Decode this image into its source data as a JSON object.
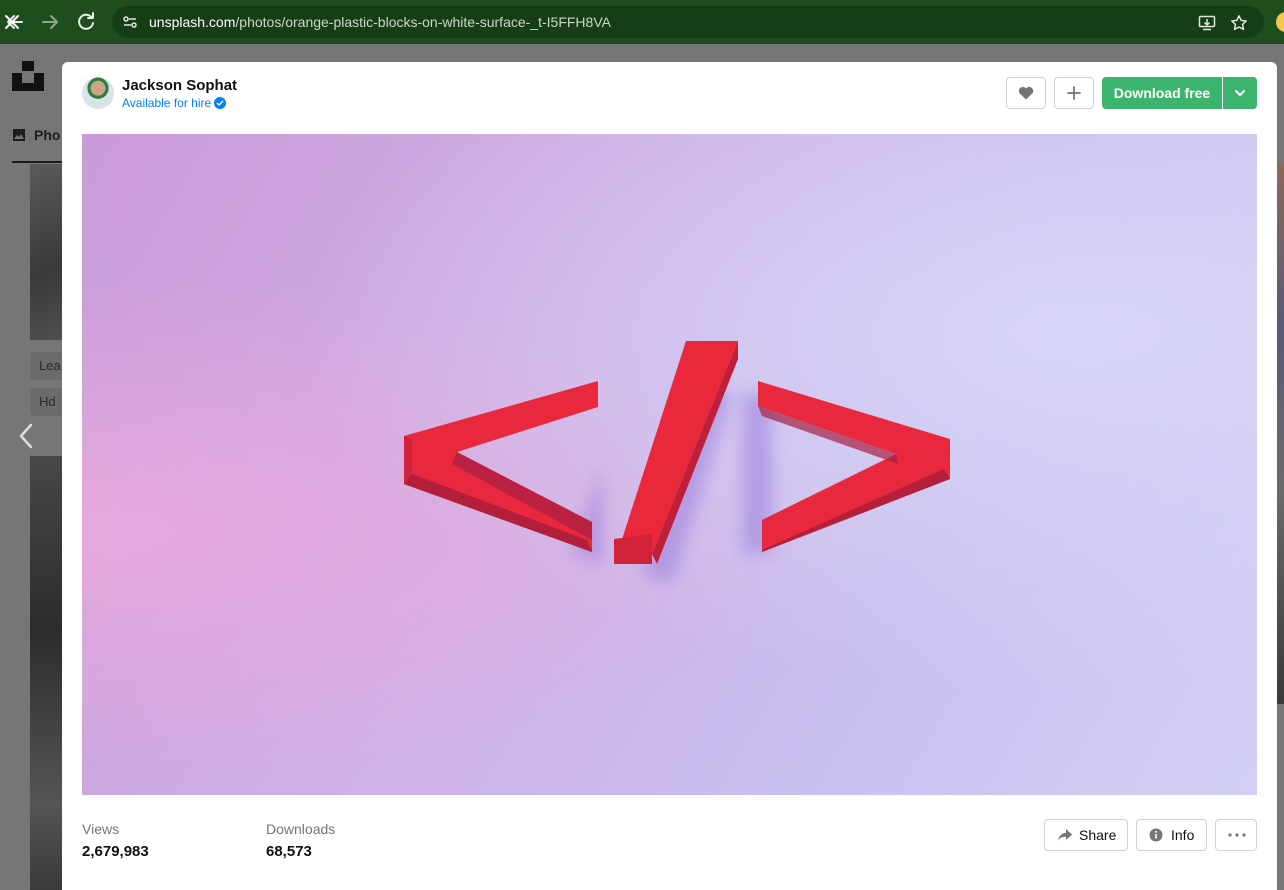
{
  "browser": {
    "url_host": "unsplash.com",
    "url_path": "/photos/orange-plastic-blocks-on-white-surface-_t-I5FFH8VA"
  },
  "background_page": {
    "tab_label": "Pho",
    "chip1": "Lea",
    "chip2": "Hd"
  },
  "modal": {
    "author": {
      "name": "Jackson Sophat",
      "hire_label": "Available for hire"
    },
    "actions": {
      "download_label": "Download free"
    },
    "photo": {
      "subject_icon": "code-tag-icon"
    },
    "stats": {
      "views_label": "Views",
      "views_value": "2,679,983",
      "downloads_label": "Downloads",
      "downloads_value": "68,573"
    },
    "footer": {
      "share_label": "Share",
      "info_label": "Info"
    }
  },
  "colors": {
    "accent_green": "#3cb46e",
    "link_blue": "#007fff"
  }
}
